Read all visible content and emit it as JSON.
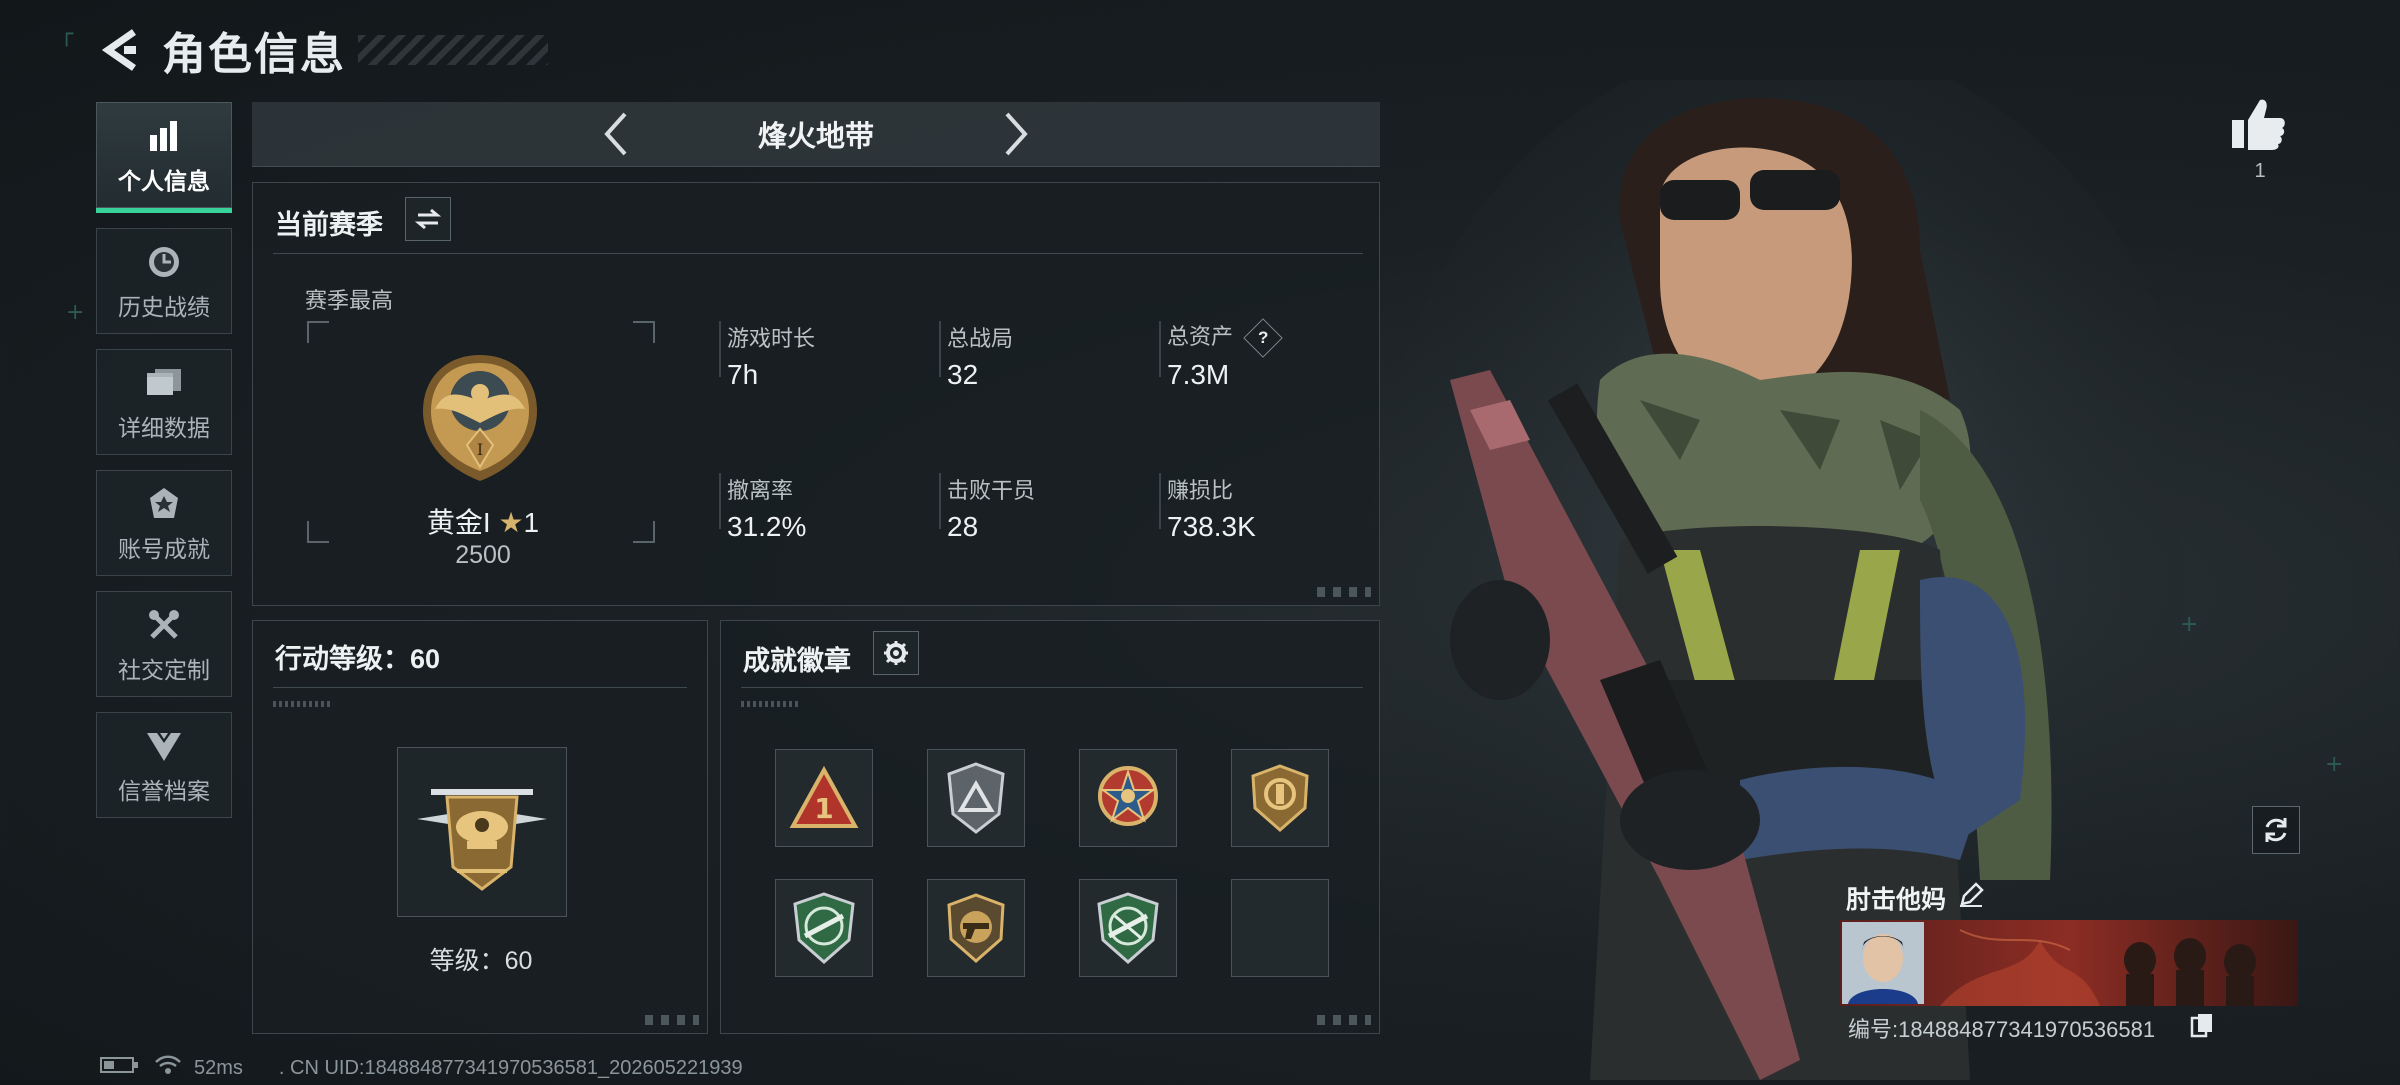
{
  "header": {
    "title": "角色信息"
  },
  "sidebar": {
    "items": [
      {
        "label": "个人信息",
        "icon": "bar-chart-icon",
        "active": true
      },
      {
        "label": "历史战绩",
        "icon": "history-clock-icon"
      },
      {
        "label": "详细数据",
        "icon": "folder-data-icon"
      },
      {
        "label": "账号成就",
        "icon": "achievement-icon"
      },
      {
        "label": "社交定制",
        "icon": "tools-icon"
      },
      {
        "label": "信誉档案",
        "icon": "reputation-icon"
      }
    ]
  },
  "mode_nav": {
    "title": "烽火地带"
  },
  "season": {
    "title": "当前赛季",
    "best_label": "赛季最高",
    "rank_name": "黄金I",
    "rank_stars": "1",
    "rank_score": "2500",
    "stats": [
      {
        "label": "游戏时长",
        "value": "7h"
      },
      {
        "label": "总战局",
        "value": "32"
      },
      {
        "label": "总资产",
        "value": "7.3M",
        "help": "?"
      },
      {
        "label": "撤离率",
        "value": "31.2%"
      },
      {
        "label": "击败干员",
        "value": "28"
      },
      {
        "label": "赚损比",
        "value": "738.3K"
      }
    ]
  },
  "level": {
    "title": "行动等级：60",
    "caption": "等级：60"
  },
  "achievements": {
    "title": "成就徽章",
    "badges": [
      {
        "icon": "triangle-rank-1-badge-icon"
      },
      {
        "icon": "silver-triangle-shield-badge-icon"
      },
      {
        "icon": "star-medal-badge-icon"
      },
      {
        "icon": "gold-shield-badge-icon"
      },
      {
        "icon": "green-rifle-badge-icon"
      },
      {
        "icon": "gold-pistol-badge-icon"
      },
      {
        "icon": "green-rifle-badge-2-icon"
      },
      {
        "icon": "empty-slot"
      }
    ]
  },
  "profile": {
    "likes": "1",
    "player_name": "肘击他妈",
    "player_id": "编号:1848848773419705365​81"
  },
  "status": {
    "ping": "52ms",
    "uid": ". CN UID:1848848773419705365​81_202605221939"
  },
  "colors": {
    "accent": "#37d39b",
    "panel": "#182024",
    "text": "#eef1f2"
  }
}
